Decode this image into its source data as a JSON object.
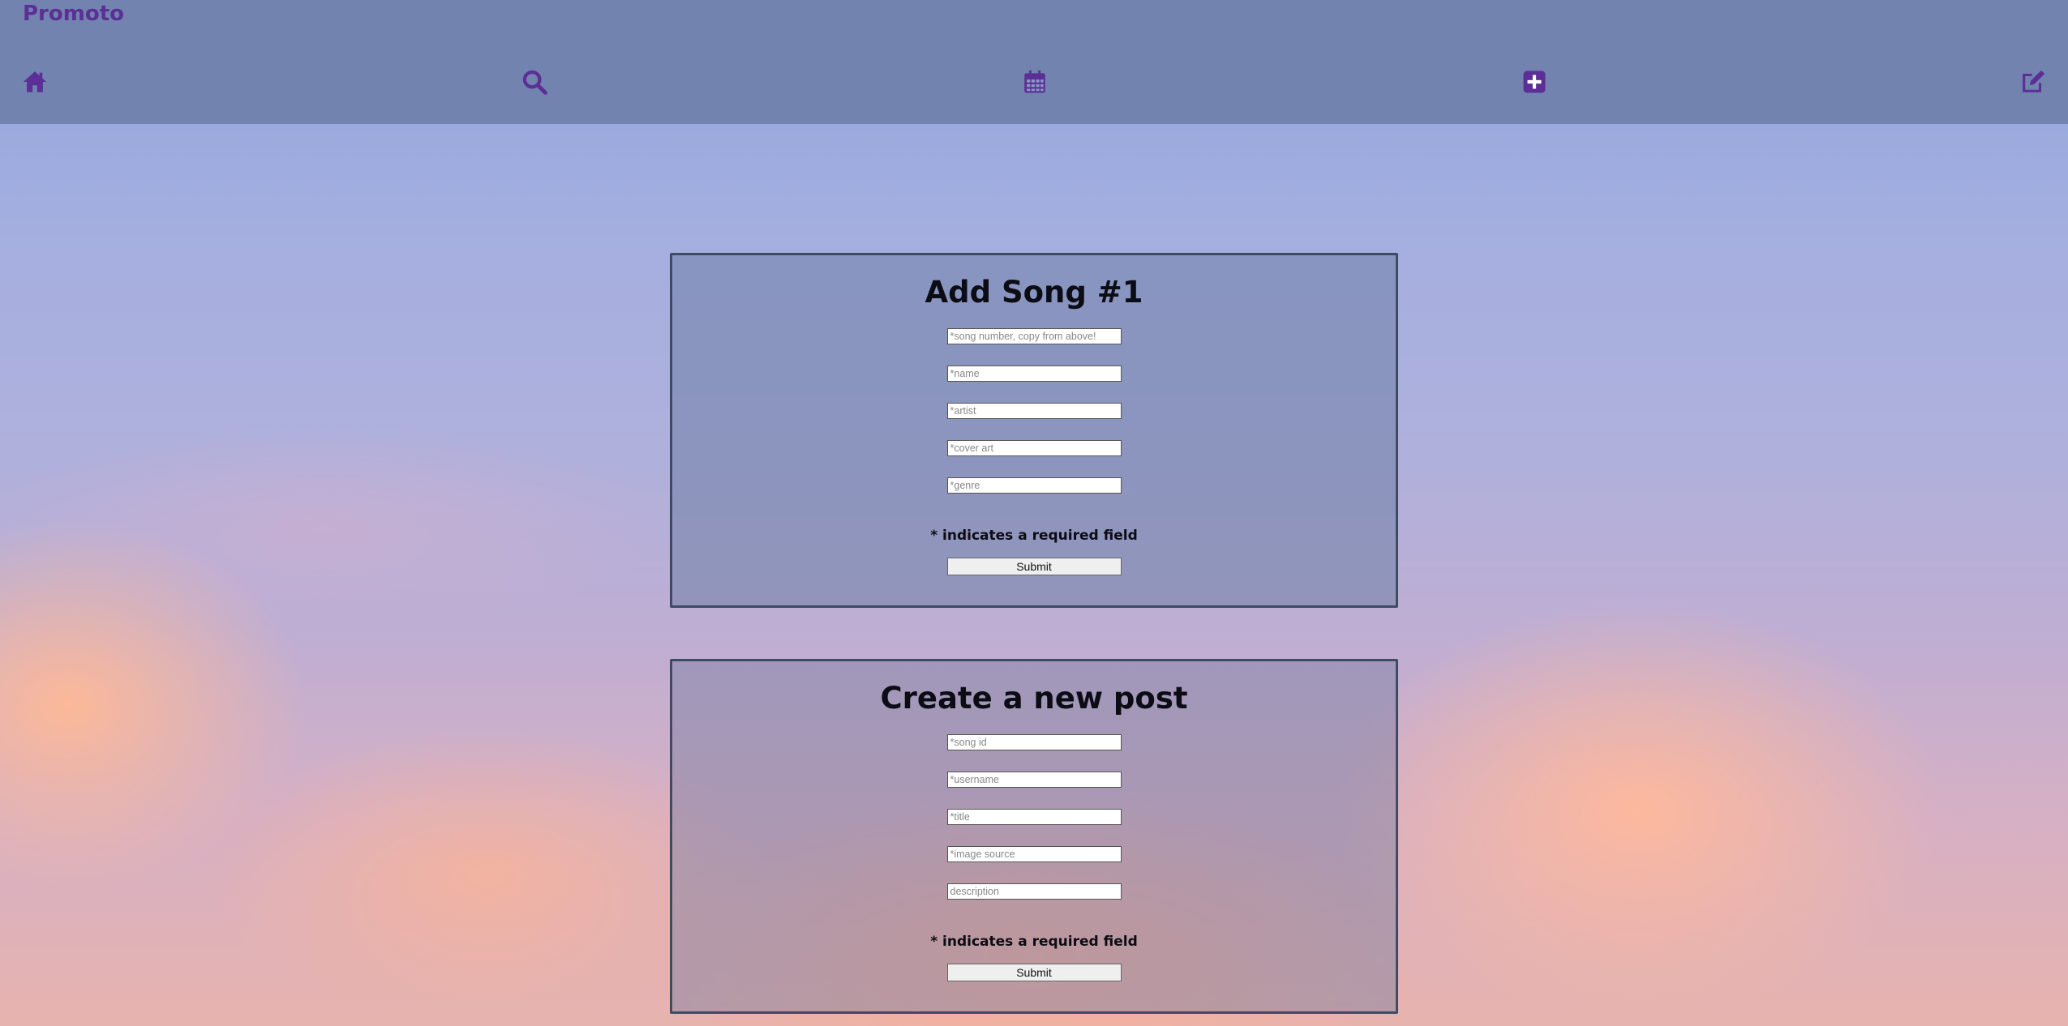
{
  "app": {
    "brand": "Promoto"
  },
  "nav": {
    "icons": [
      "home-icon",
      "search-icon",
      "calendar-icon",
      "plus-square-icon",
      "edit-icon"
    ],
    "color": "#5b2f95"
  },
  "add_song_form": {
    "title": "Add Song #1",
    "fields": {
      "song_number": "*song number, copy from above!",
      "name": "*name",
      "artist": "*artist",
      "cover_art": "*cover art",
      "genre": "*genre"
    },
    "required_note": "* indicates a required field",
    "submit_label": "Submit"
  },
  "new_post_form": {
    "title": "Create a new post",
    "fields": {
      "song_id": "*song id",
      "username": "*username",
      "title": "*title",
      "image_source": "*image source",
      "description": "description"
    },
    "required_note": "* indicates a required field",
    "submit_label": "Submit"
  }
}
